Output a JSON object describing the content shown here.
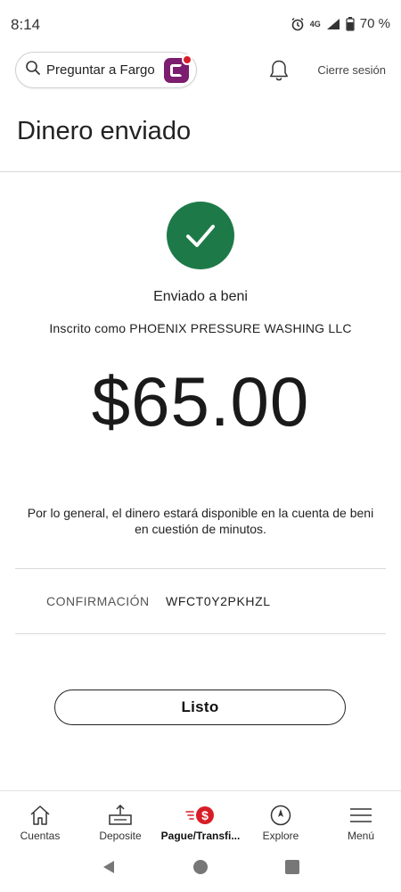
{
  "status_bar": {
    "time": "8:14",
    "network": "4G",
    "battery": "70 %",
    "icons": [
      "alarm-icon",
      "network-4g-icon",
      "signal-icon",
      "battery-icon"
    ]
  },
  "header": {
    "ask_fargo_label": "Preguntar a Fargo",
    "sign_out_label": "Cierre sesión",
    "icons": [
      "search-icon",
      "fargo-icon",
      "bell-icon"
    ]
  },
  "page": {
    "title": "Dinero enviado"
  },
  "confirmation": {
    "sent_to": "Enviado a beni",
    "enrolled_as": "Inscrito como PHOENIX PRESSURE WASHING LLC",
    "amount": "$65.00",
    "availability_note": "Por lo general, el dinero estará disponible en la cuenta de beni en cuestión de minutos.",
    "confirmation_label": "CONFIRMACIÓN",
    "confirmation_code": "WFCT0Y2PKHZL",
    "done_button_label": "Listo"
  },
  "bottom_nav": {
    "items": [
      {
        "label": "Cuentas",
        "icon": "home-icon"
      },
      {
        "label": "Deposite",
        "icon": "deposit-icon"
      },
      {
        "label": "Pague/Transfi...",
        "icon": "pay-transfer-icon",
        "active": true
      },
      {
        "label": "Explore",
        "icon": "compass-icon"
      },
      {
        "label": "Menú",
        "icon": "menu-icon"
      }
    ]
  },
  "colors": {
    "success_green": "#1d7a48",
    "brand_red": "#d71e28",
    "fargo_purple": "#7c1d6f",
    "divider": "#d9d9d9"
  }
}
